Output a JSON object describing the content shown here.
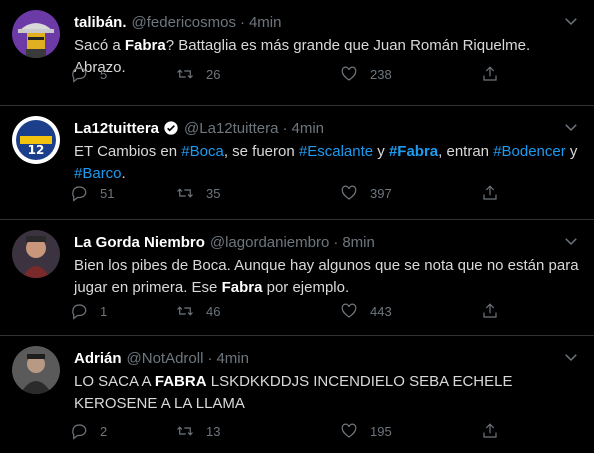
{
  "tweets": [
    {
      "name": "talibán.",
      "handle": "@federicosmos",
      "dot": "·",
      "time": "4min",
      "verified": false,
      "text": [
        {
          "t": "Sacó a ",
          "s": "plain"
        },
        {
          "t": "Fabra",
          "s": "bold"
        },
        {
          "t": "? Battaglia es más grande que Juan Román Riquelme. Abrazo.",
          "s": "plain"
        }
      ],
      "replies": "5",
      "retweets": "26",
      "likes": "238"
    },
    {
      "name": "La12tuittera",
      "handle": "@La12tuittera",
      "dot": "·",
      "time": "4min",
      "verified": true,
      "text": [
        {
          "t": "ET Cambios en ",
          "s": "plain"
        },
        {
          "t": "#Boca",
          "s": "link"
        },
        {
          "t": ", se fueron ",
          "s": "plain"
        },
        {
          "t": "#Escalante",
          "s": "link"
        },
        {
          "t": " y ",
          "s": "plain"
        },
        {
          "t": "#Fabra",
          "s": "link-bold"
        },
        {
          "t": ", entran ",
          "s": "plain"
        },
        {
          "t": "#Bodencer",
          "s": "link"
        },
        {
          "t": " y ",
          "s": "plain"
        },
        {
          "t": "#Barco",
          "s": "link"
        },
        {
          "t": ".",
          "s": "plain"
        }
      ],
      "replies": "51",
      "retweets": "35",
      "likes": "397"
    },
    {
      "name": "La Gorda Niembro",
      "handle": "@lagordaniembro",
      "dot": "·",
      "time": "8min",
      "verified": false,
      "text": [
        {
          "t": "Bien los pibes de Boca. Aunque hay algunos que se nota que no están para jugar en primera. Ese ",
          "s": "plain"
        },
        {
          "t": "Fabra",
          "s": "bold"
        },
        {
          "t": " por ejemplo.",
          "s": "plain"
        }
      ],
      "replies": "1",
      "retweets": "46",
      "likes": "443"
    },
    {
      "name": "Adrián",
      "handle": "@NotAdroll",
      "dot": "·",
      "time": "4min",
      "verified": false,
      "text": [
        {
          "t": "LO SACA A ",
          "s": "plain"
        },
        {
          "t": "FABRA",
          "s": "bold"
        },
        {
          "t": " LSKDKKDDJS INCENDIELO SEBA ECHELE KEROSENE A LA LLAMA",
          "s": "plain"
        }
      ],
      "replies": "2",
      "retweets": "13",
      "likes": "195"
    }
  ],
  "icons": {
    "reply": "reply-icon",
    "retweet": "retweet-icon",
    "like": "like-icon",
    "share": "share-icon",
    "more": "chevron-down-icon",
    "verified": "verified-badge-icon"
  },
  "colors": {
    "background": "#000000",
    "text": "#d9d9d9",
    "muted": "#6e767d",
    "link": "#1d9bf0",
    "divider": "#2f3336"
  }
}
